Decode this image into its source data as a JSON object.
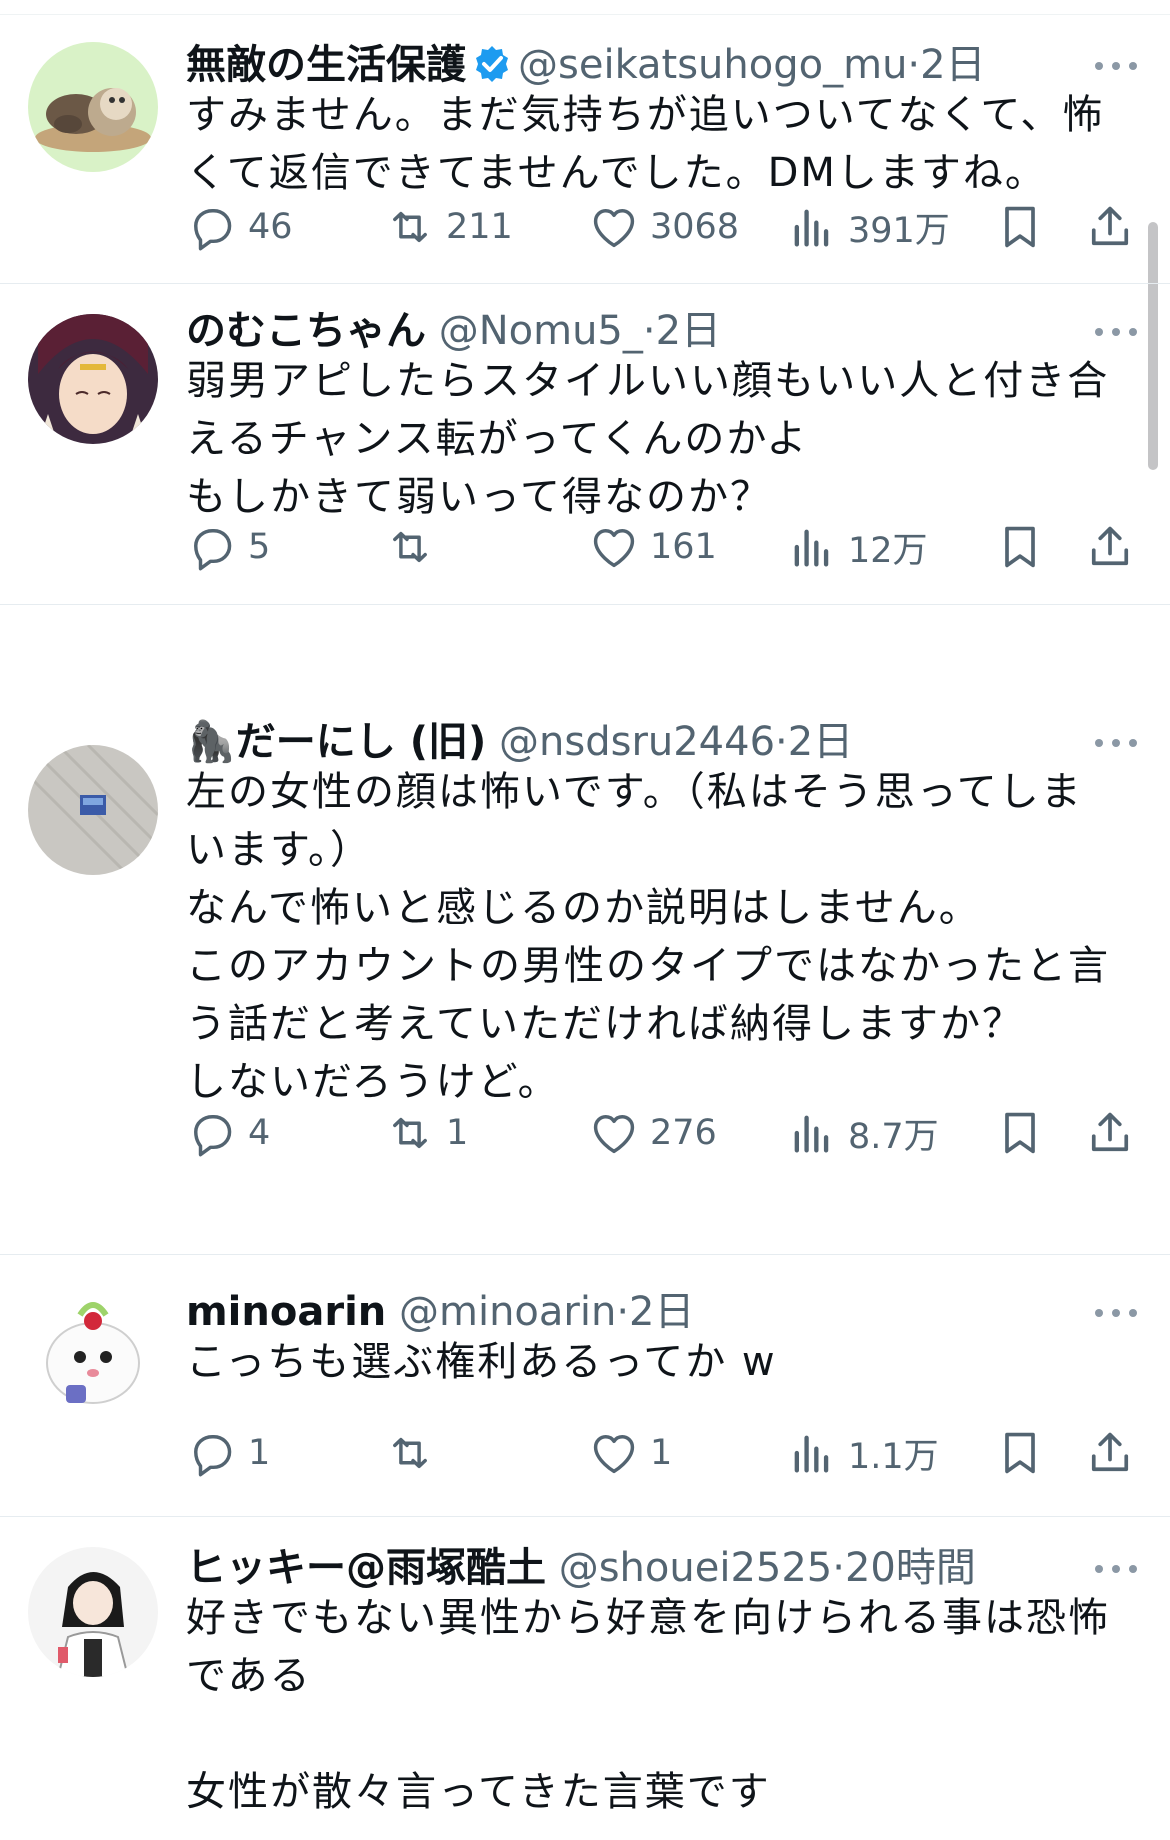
{
  "tweets": [
    {
      "name": "無敵の生活保護",
      "verified": true,
      "handle": "@seikatsuhogo_mu",
      "dot": "·",
      "time": "2日",
      "lines": [
        "すみません。まだ気持ちが追いついてなくて、怖",
        "くて返信できてませんでした。DMしますね。"
      ],
      "replies": "46",
      "retweets": "211",
      "likes": "3068",
      "views": "391万",
      "avatar_bg": "#d9f2c7"
    },
    {
      "name": "のむこちゃん",
      "verified": false,
      "handle": "@Nomu5_",
      "dot": "·",
      "time": "2日",
      "lines": [
        "弱男アピしたらスタイルいい顔もいい人と付き合",
        "えるチャンス転がってくんのかよ",
        "もしかきて弱いって得なのか？"
      ],
      "replies": "5",
      "retweets": "",
      "likes": "161",
      "views": "12万",
      "avatar_bg": "#3d2a3f"
    },
    {
      "name": "🦍だーにし (旧)",
      "verified": false,
      "handle": "@nsdsru2446",
      "dot": "·",
      "time": "2日",
      "lines": [
        "左の女性の顔は怖いです。（私はそう思ってしま",
        "います。）",
        "なんで怖いと感じるのか説明はしません。",
        "このアカウントの男性のタイプではなかったと言",
        "う話だと考えていただければ納得しますか？",
        "しないだろうけど。"
      ],
      "replies": "4",
      "retweets": "1",
      "likes": "276",
      "views": "8.7万",
      "avatar_bg": "#c9c7c2"
    },
    {
      "name": "minoarin",
      "verified": false,
      "handle": "@minoarin",
      "dot": "·",
      "time": "2日",
      "lines": [
        "こっちも選ぶ権利あるってか w"
      ],
      "replies": "1",
      "retweets": "",
      "likes": "1",
      "views": "1.1万",
      "avatar_bg": "#ffffff"
    },
    {
      "name": "ヒッキー@雨塚酷土",
      "verified": false,
      "handle": "@shouei2525",
      "dot": "·",
      "time": "20時間",
      "lines": [
        "好きでもない異性から好意を向けられる事は恐怖",
        "である",
        "",
        "女性が散々言ってきた言葉です"
      ],
      "replies": "",
      "retweets": "",
      "likes": "",
      "views": "",
      "avatar_bg": "#f4f4f4"
    }
  ],
  "colors": {
    "text": "#0f1419",
    "secondary": "#536471",
    "verified": "#1d9bf0",
    "divider": "#e6ecf0"
  }
}
